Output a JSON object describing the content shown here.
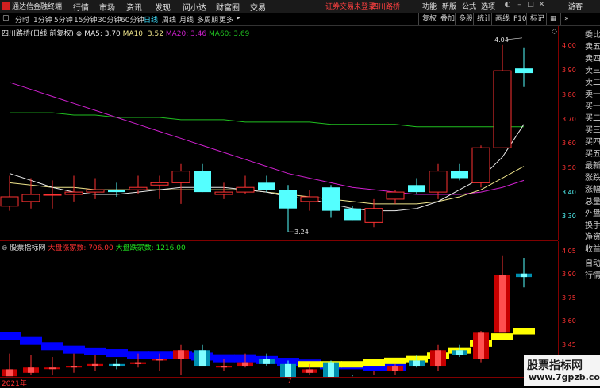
{
  "app": {
    "title": "通达信金融终端"
  },
  "menu": [
    "行情",
    "市场",
    "资讯",
    "发现",
    "问小达",
    "财富圈",
    "交易"
  ],
  "login_status": "证券交易未登录",
  "stock_name_top": "四川路桥",
  "right_menu": [
    "功能",
    "新版",
    "公式",
    "选项",
    "游客"
  ],
  "toolbar": {
    "periods": [
      "分时",
      "1分钟",
      "5分钟",
      "15分钟",
      "30分钟",
      "60分钟",
      "日线",
      "周线",
      "月线",
      "多周期",
      "更多"
    ],
    "active_period": "日线",
    "right_buttons": [
      "复权",
      "叠加",
      "多股",
      "统计",
      "画线",
      "F10",
      "标记"
    ]
  },
  "price_panel": {
    "title": "四川路桥(日线 前复权)",
    "ma_legend": [
      {
        "label": "MA5: 3.70",
        "color": "#e8e8e8"
      },
      {
        "label": "MA10: 3.52",
        "color": "#f0e68c"
      },
      {
        "label": "MA20: 3.46",
        "color": "#d020d0"
      },
      {
        "label": "MA60: 3.69",
        "color": "#20c020"
      }
    ],
    "high_label": "4.04",
    "low_label": "3.24",
    "y_ticks": [
      "4.00",
      "3.90",
      "3.80",
      "3.70",
      "3.60",
      "3.50",
      "3.40",
      "3.30"
    ]
  },
  "indicator_panel": {
    "title": "股票指标网",
    "legend_1": "大盘涨家数: 706.00",
    "legend_2": "大盘跌家数: 1216.00",
    "y_ticks": [
      "4.05",
      "3.90",
      "3.75",
      "3.60",
      "3.45"
    ]
  },
  "right_panel_items": [
    "委比",
    "卖五",
    "卖四",
    "卖三",
    "卖二",
    "卖一",
    "买一",
    "买二",
    "买三",
    "买四",
    "买五",
    "最新",
    "涨跌",
    "涨幅",
    "总量",
    "外盘",
    "换手",
    "净资",
    "收益",
    "自动",
    "行情"
  ],
  "footer": {
    "year_label": "2021年",
    "month_label": "7"
  },
  "watermark": {
    "title": "股票指标网",
    "url": "www.7gpzb.com"
  },
  "colors": {
    "up": "#ff3232",
    "down": "#54ffff",
    "grid": "#800000",
    "yellow": "#ffff00",
    "blue": "#0000ff"
  },
  "chart_data": {
    "type": "candlestick",
    "candles": [
      {
        "o": 3.35,
        "h": 3.48,
        "l": 3.33,
        "c": 3.39
      },
      {
        "o": 3.37,
        "h": 3.47,
        "l": 3.34,
        "c": 3.4
      },
      {
        "o": 3.4,
        "h": 3.46,
        "l": 3.34,
        "c": 3.4
      },
      {
        "o": 3.4,
        "h": 3.48,
        "l": 3.37,
        "c": 3.41
      },
      {
        "o": 3.41,
        "h": 3.47,
        "l": 3.38,
        "c": 3.42
      },
      {
        "o": 3.42,
        "h": 3.45,
        "l": 3.39,
        "c": 3.41
      },
      {
        "o": 3.42,
        "h": 3.48,
        "l": 3.4,
        "c": 3.43
      },
      {
        "o": 3.44,
        "h": 3.48,
        "l": 3.38,
        "c": 3.45
      },
      {
        "o": 3.45,
        "h": 3.53,
        "l": 3.36,
        "c": 3.5
      },
      {
        "o": 3.5,
        "h": 3.53,
        "l": 3.41,
        "c": 3.41
      },
      {
        "o": 3.4,
        "h": 3.45,
        "l": 3.38,
        "c": 3.41
      },
      {
        "o": 3.41,
        "h": 3.48,
        "l": 3.4,
        "c": 3.43
      },
      {
        "o": 3.45,
        "h": 3.48,
        "l": 3.41,
        "c": 3.42
      },
      {
        "o": 3.42,
        "h": 3.44,
        "l": 3.24,
        "c": 3.34
      },
      {
        "o": 3.37,
        "h": 3.42,
        "l": 3.33,
        "c": 3.39
      },
      {
        "o": 3.43,
        "h": 3.44,
        "l": 3.3,
        "c": 3.33
      },
      {
        "o": 3.34,
        "h": 3.35,
        "l": 3.29,
        "c": 3.29
      },
      {
        "o": 3.28,
        "h": 3.38,
        "l": 3.26,
        "c": 3.34
      },
      {
        "o": 3.38,
        "h": 3.42,
        "l": 3.36,
        "c": 3.41
      },
      {
        "o": 3.44,
        "h": 3.47,
        "l": 3.4,
        "c": 3.41
      },
      {
        "o": 3.41,
        "h": 3.53,
        "l": 3.38,
        "c": 3.5
      },
      {
        "o": 3.5,
        "h": 3.53,
        "l": 3.46,
        "c": 3.47
      },
      {
        "o": 3.45,
        "h": 3.61,
        "l": 3.43,
        "c": 3.6
      },
      {
        "o": 3.6,
        "h": 4.04,
        "l": 3.63,
        "c": 3.93
      },
      {
        "o": 3.94,
        "h": 4.03,
        "l": 3.86,
        "c": 3.92
      }
    ],
    "ma5": [
      3.49,
      3.46,
      3.43,
      3.41,
      3.4,
      3.4,
      3.41,
      3.42,
      3.43,
      3.43,
      3.43,
      3.42,
      3.41,
      3.39,
      3.38,
      3.36,
      3.34,
      3.33,
      3.33,
      3.34,
      3.37,
      3.42,
      3.47,
      3.56,
      3.7
    ],
    "ma10": [
      3.45,
      3.44,
      3.43,
      3.43,
      3.42,
      3.42,
      3.42,
      3.42,
      3.42,
      3.42,
      3.42,
      3.42,
      3.41,
      3.4,
      3.39,
      3.38,
      3.37,
      3.36,
      3.36,
      3.36,
      3.37,
      3.39,
      3.42,
      3.47,
      3.52
    ],
    "ma20": [
      3.88,
      3.85,
      3.82,
      3.79,
      3.76,
      3.73,
      3.7,
      3.67,
      3.64,
      3.61,
      3.58,
      3.55,
      3.52,
      3.49,
      3.47,
      3.45,
      3.43,
      3.42,
      3.41,
      3.4,
      3.4,
      3.4,
      3.41,
      3.43,
      3.46
    ],
    "ma60": [
      3.75,
      3.75,
      3.75,
      3.74,
      3.74,
      3.73,
      3.73,
      3.73,
      3.72,
      3.72,
      3.72,
      3.71,
      3.71,
      3.71,
      3.71,
      3.7,
      3.7,
      3.7,
      3.7,
      3.69,
      3.69,
      3.69,
      3.69,
      3.69,
      3.69
    ],
    "ylim": [
      3.22,
      4.08
    ]
  },
  "indicator_data": {
    "ylim": [
      3.36,
      4.08
    ],
    "blue_line": [
      3.56,
      3.53,
      3.5,
      3.48,
      3.47,
      3.46,
      3.45,
      3.45,
      3.45,
      3.44,
      3.43,
      3.43,
      3.42,
      3.41,
      3.4,
      3.39,
      3.39,
      3.38,
      3.38
    ],
    "yellow_line": [
      3.4,
      3.4,
      3.4,
      3.41,
      3.42,
      3.43,
      3.45,
      3.48,
      3.52,
      3.56,
      3.59,
      3.62
    ],
    "yellow_start": 14
  }
}
